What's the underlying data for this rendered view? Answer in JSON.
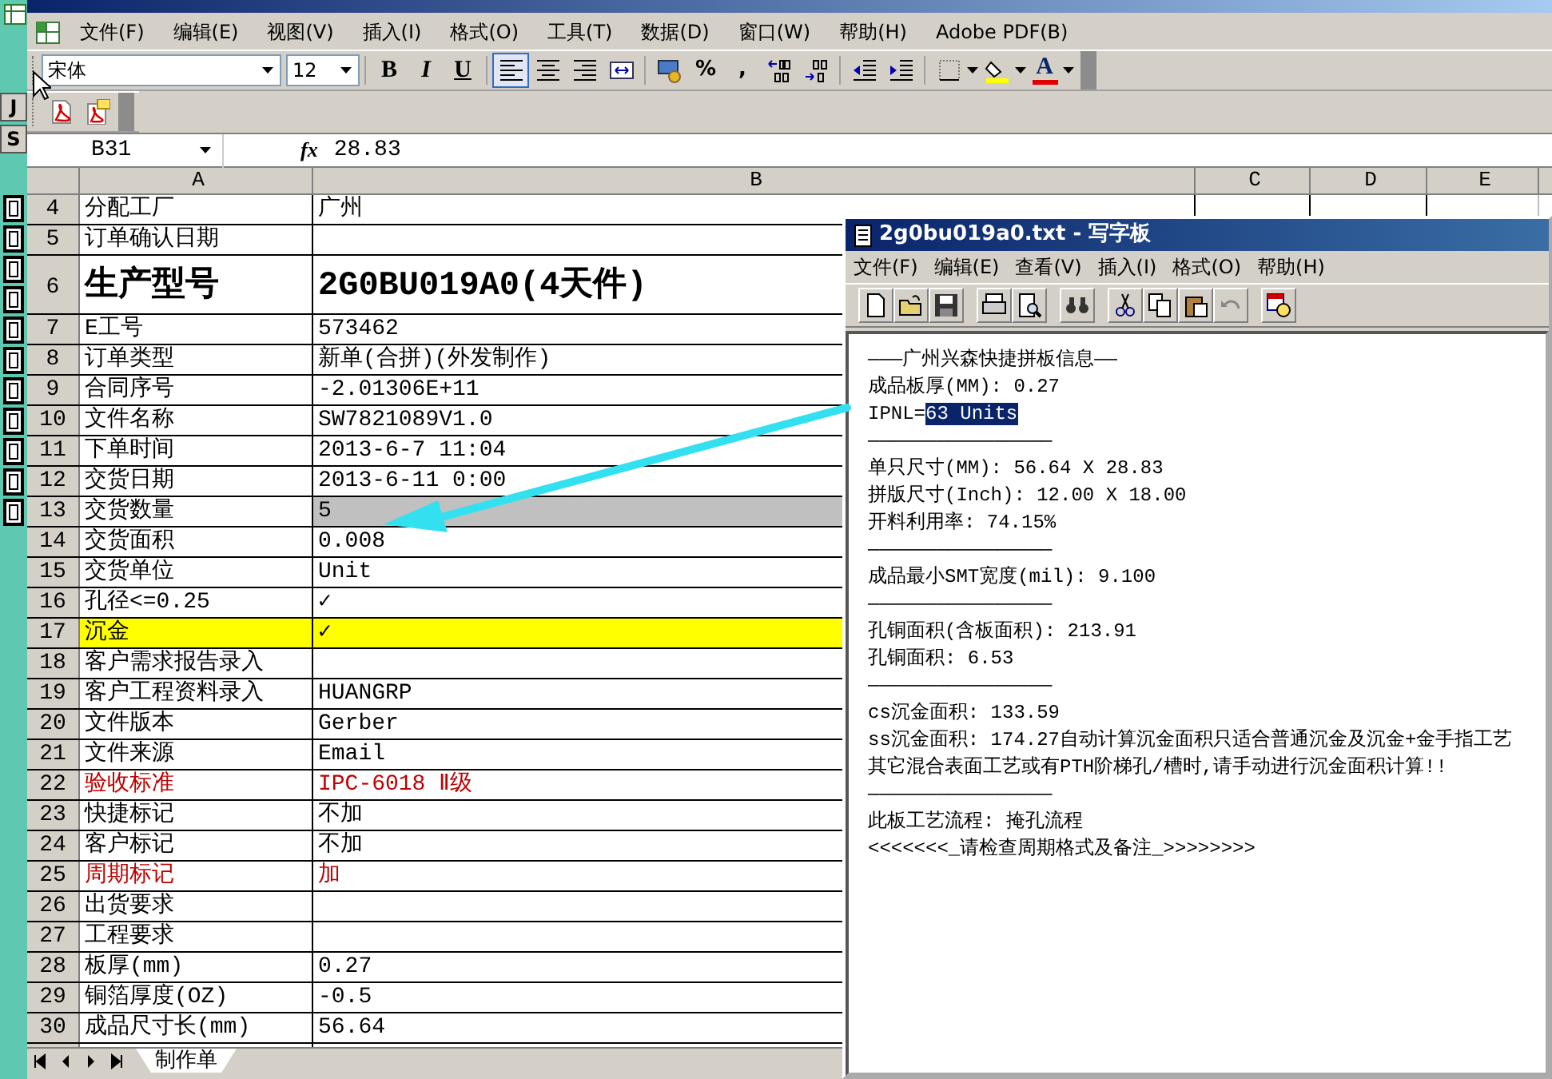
{
  "left_strip": {
    "letters": [
      "J",
      "S"
    ]
  },
  "excel": {
    "menu": [
      "文件(F)",
      "编辑(E)",
      "视图(V)",
      "插入(I)",
      "格式(O)",
      "工具(T)",
      "数据(D)",
      "窗口(W)",
      "帮助(H)",
      "Adobe PDF(B)"
    ],
    "format_toolbar": {
      "font": "宋体",
      "size": "12",
      "style_buttons": [
        "B",
        "I",
        "U"
      ],
      "alignment": [
        {
          "selected": true
        },
        {
          "selected": false
        },
        {
          "selected": false
        },
        {
          "selected": false
        }
      ],
      "number_buttons": [
        "%",
        ","
      ],
      "font_color": "A"
    },
    "formula_bar": {
      "name_box": "B31",
      "fx": "fx",
      "value": "28.83"
    },
    "columns": [
      "A",
      "B",
      "C",
      "D",
      "E"
    ],
    "rows": [
      {
        "num": "4",
        "label": "分配工厂",
        "value": "广州",
        "kind": "normal"
      },
      {
        "num": "5",
        "label": "订单确认日期",
        "value": "",
        "kind": "normal"
      },
      {
        "num": "6",
        "label": "生产型号",
        "value": "2G0BU019A0(4天件)",
        "kind": "title"
      },
      {
        "num": "7",
        "label": "E工号",
        "value": "573462",
        "kind": "normal"
      },
      {
        "num": "8",
        "label": "订单类型",
        "value": "新单(合拼)(外发制作)",
        "kind": "normal"
      },
      {
        "num": "9",
        "label": "合同序号",
        "value": "-2.01306E+11",
        "kind": "normal"
      },
      {
        "num": "10",
        "label": "文件名称",
        "value": "SW7821089V1.0",
        "kind": "normal"
      },
      {
        "num": "11",
        "label": "下单时间",
        "value": "2013-6-7 11:04",
        "kind": "normal"
      },
      {
        "num": "12",
        "label": "交货日期",
        "value": "2013-6-11 0:00",
        "kind": "normal"
      },
      {
        "num": "13",
        "label": "交货数量",
        "value": "5",
        "kind": "shaded"
      },
      {
        "num": "14",
        "label": "交货面积",
        "value": "0.008",
        "kind": "normal"
      },
      {
        "num": "15",
        "label": "交货单位",
        "value": "Unit",
        "kind": "normal"
      },
      {
        "num": "16",
        "label": "孔径<=0.25",
        "value": "✓",
        "kind": "normal"
      },
      {
        "num": "17",
        "label": "沉金",
        "value": "✓",
        "kind": "highlight"
      },
      {
        "num": "18",
        "label": "客户需求报告录入",
        "value": "",
        "kind": "normal"
      },
      {
        "num": "19",
        "label": "客户工程资料录入",
        "value": "HUANGRP",
        "kind": "normal"
      },
      {
        "num": "20",
        "label": "文件版本",
        "value": "Gerber",
        "kind": "normal"
      },
      {
        "num": "21",
        "label": "文件来源",
        "value": "Email",
        "kind": "normal"
      },
      {
        "num": "22",
        "label": "验收标准",
        "value": "IPC-6018 Ⅱ级",
        "kind": "alert"
      },
      {
        "num": "23",
        "label": "快捷标记",
        "value": "不加",
        "kind": "normal"
      },
      {
        "num": "24",
        "label": "客户标记",
        "value": "不加",
        "kind": "normal"
      },
      {
        "num": "25",
        "label": "周期标记",
        "value": "加",
        "kind": "alert"
      },
      {
        "num": "26",
        "label": "出货要求",
        "value": "",
        "kind": "normal"
      },
      {
        "num": "27",
        "label": "工程要求",
        "value": "",
        "kind": "normal"
      },
      {
        "num": "28",
        "label": "板厚(mm)",
        "value": "0.27",
        "kind": "normal"
      },
      {
        "num": "29",
        "label": "铜箔厚度(OZ)",
        "value": "-0.5",
        "kind": "normal"
      },
      {
        "num": "30",
        "label": "成品尺寸长(mm)",
        "value": "56.64",
        "kind": "normal"
      }
    ],
    "sheet_tabs": [
      {
        "label": "制作单",
        "selected": true
      }
    ]
  },
  "wordpad": {
    "title": "2g0bu019a0.txt - 写字板",
    "menu": [
      "文件(F)",
      "编辑(E)",
      "查看(V)",
      "插入(I)",
      "格式(O)",
      "帮助(H)"
    ],
    "lines": [
      {
        "text": "———广州兴森快捷拼板信息——"
      },
      {
        "text": "成品板厚(MM): 0.27"
      },
      {
        "text": "IPNL=",
        "selection": "63 Units"
      },
      {
        "text": "————————————————"
      },
      {
        "text": "单只尺寸(MM): 56.64 X 28.83"
      },
      {
        "text": "拼版尺寸(Inch): 12.00 X 18.00"
      },
      {
        "text": "开料利用率: 74.15%"
      },
      {
        "text": "————————————————"
      },
      {
        "text": "成品最小SMT宽度(mil): 9.100"
      },
      {
        "text": "————————————————"
      },
      {
        "text": "孔铜面积(含板面积): 213.91"
      },
      {
        "text": "孔铜面积: 6.53"
      },
      {
        "text": "————————————————"
      },
      {
        "text": "cs沉金面积: 133.59"
      },
      {
        "text": "ss沉金面积: 174.27自动计算沉金面积只适合普通沉金及沉金+金手指工艺"
      },
      {
        "text": "其它混合表面工艺或有PTH阶梯孔/槽时,请手动进行沉金面积计算!!"
      },
      {
        "text": "————————————————"
      },
      {
        "text": "此板工艺流程: 掩孔流程"
      },
      {
        "text": "<<<<<<<_请检查周期格式及备注_>>>>>>>>"
      }
    ]
  }
}
